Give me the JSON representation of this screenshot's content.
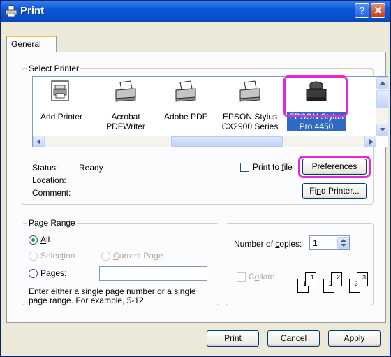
{
  "window": {
    "title": "Print",
    "help_label": "?",
    "close_label": "✕",
    "icon": "printer-icon"
  },
  "tabs": [
    {
      "label": "General",
      "active": true
    }
  ],
  "select_printer": {
    "legend": "Select Printer",
    "printers": [
      {
        "name": "Add Printer",
        "line2": "",
        "icon": "add-printer-icon"
      },
      {
        "name": "Acrobat",
        "line2": "PDFWriter",
        "icon": "printer-icon"
      },
      {
        "name": "Adobe PDF",
        "line2": "",
        "icon": "printer-icon"
      },
      {
        "name": "EPSON Stylus",
        "line2": "CX2900 Series",
        "icon": "printer-icon"
      },
      {
        "name": "EPSON Stylus",
        "line2": "Pro 4450",
        "icon": "printer-icon",
        "selected": true
      }
    ],
    "status_label": "Status:",
    "status_value": "Ready",
    "location_label": "Location:",
    "comment_label": "Comment:",
    "print_to_file": {
      "pre": "Print to ",
      "accel": "f",
      "post": "ile",
      "checked": false
    },
    "preferences": {
      "accel": "P",
      "rest": "references"
    },
    "find_printer": {
      "pre": "Fi",
      "accel": "n",
      "post": "d Printer..."
    }
  },
  "page_range": {
    "legend": "Page Range",
    "all": {
      "accel": "A",
      "rest": "ll",
      "checked": true
    },
    "selection": {
      "pre": "Selec",
      "accel": "t",
      "post": "ion",
      "enabled": false
    },
    "current_page": {
      "accel": "C",
      "rest": "urrent Page",
      "enabled": false
    },
    "pages": {
      "pre": "Pa",
      "accel": "g",
      "post": "es:",
      "value": ""
    },
    "help_line1": "Enter either a single page number or a single",
    "help_line2": "page range.  For example, 5-12"
  },
  "copies": {
    "label_pre": "Number of ",
    "label_accel": "c",
    "label_post": "opies:",
    "value": "1",
    "collate": {
      "pre": "C",
      "accel": "o",
      "post": "llate",
      "checked": false,
      "enabled": false
    },
    "collate_pages": [
      "1",
      "1",
      "2",
      "2",
      "3",
      "3"
    ]
  },
  "footer": {
    "print": {
      "accel": "P",
      "rest": "rint"
    },
    "cancel": "Cancel",
    "apply": {
      "accel": "A",
      "rest": "pply"
    }
  },
  "colors": {
    "highlight": "#e52bd0",
    "selection": "#316ac5",
    "titlebar": "#0a58d8"
  }
}
